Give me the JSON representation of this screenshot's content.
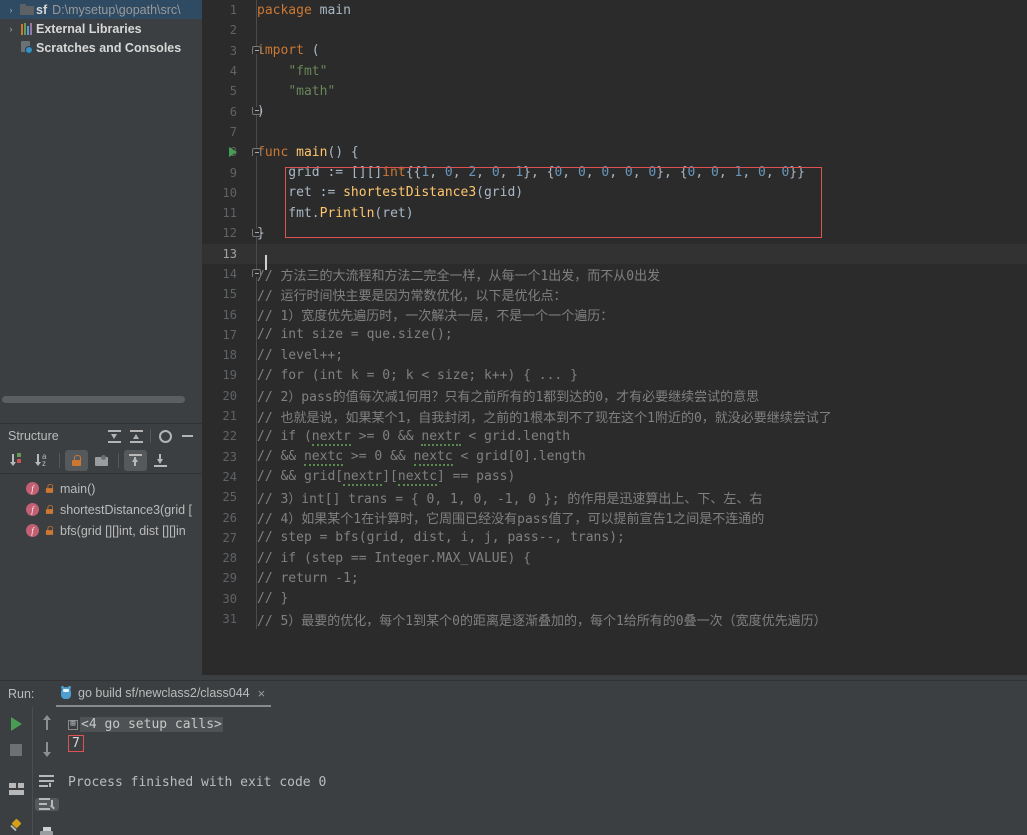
{
  "project": {
    "items": [
      {
        "arrow": "›",
        "icon": "folder-icon",
        "name": "sf",
        "path": "D:\\mysetup\\gopath\\src\\",
        "selected": true
      },
      {
        "arrow": "›",
        "icon": "external-libraries-icon",
        "name": "External Libraries",
        "path": "",
        "selected": false
      },
      {
        "arrow": "",
        "icon": "scratches-icon",
        "name": "Scratches and Consoles",
        "path": "",
        "selected": false
      }
    ]
  },
  "structure": {
    "title": "Structure",
    "header_buttons": [
      {
        "name": "expand-all-button",
        "icon": "expand-all-icon"
      },
      {
        "name": "collapse-all-button",
        "icon": "collapse-all-icon"
      },
      {
        "name": "settings-button",
        "icon": "gear-icon"
      },
      {
        "name": "hide-button",
        "icon": "minus-icon"
      }
    ],
    "toolbar_buttons": [
      {
        "name": "sort-by-visibility-button",
        "icon": "sort-visibility-icon",
        "active": false
      },
      {
        "name": "sort-alphabetically-button",
        "icon": "sort-alpha-icon",
        "active": false
      },
      {
        "name": "show-non-public-button",
        "icon": "lock-icon",
        "active": true
      },
      {
        "name": "show-anonymous-button",
        "icon": "anonymous-classes-icon",
        "active": false
      },
      {
        "name": "show-inherited-button",
        "icon": "arrow-up-bar-icon",
        "active": true
      },
      {
        "name": "show-imported-button",
        "icon": "arrow-down-bar-icon",
        "active": false
      }
    ],
    "items": [
      {
        "kind": "f",
        "label": "main()"
      },
      {
        "kind": "f",
        "label": "shortestDistance3(grid ["
      },
      {
        "kind": "f",
        "label": "bfs(grid [][]int, dist [][]in"
      }
    ]
  },
  "editor": {
    "lines": [
      {
        "n": 1,
        "fold": "",
        "run": false,
        "segs": [
          {
            "t": "package ",
            "c": "kw"
          },
          {
            "t": "main",
            "c": "txt"
          }
        ]
      },
      {
        "n": 2,
        "fold": "",
        "run": false,
        "segs": []
      },
      {
        "n": 3,
        "fold": "start",
        "run": false,
        "segs": [
          {
            "t": "import",
            "c": "kw"
          },
          {
            "t": " (",
            "c": "txt"
          }
        ]
      },
      {
        "n": 4,
        "fold": "",
        "run": false,
        "segs": [
          {
            "t": "    ",
            "c": "txt"
          },
          {
            "t": "\"fmt\"",
            "c": "str"
          }
        ]
      },
      {
        "n": 5,
        "fold": "",
        "run": false,
        "segs": [
          {
            "t": "    ",
            "c": "txt"
          },
          {
            "t": "\"math\"",
            "c": "str"
          }
        ]
      },
      {
        "n": 6,
        "fold": "end",
        "run": false,
        "segs": [
          {
            "t": ")",
            "c": "txt"
          }
        ]
      },
      {
        "n": 7,
        "fold": "",
        "run": false,
        "segs": []
      },
      {
        "n": 8,
        "fold": "start",
        "run": true,
        "segs": [
          {
            "t": "func ",
            "c": "kw"
          },
          {
            "t": "main",
            "c": "fn"
          },
          {
            "t": "() {",
            "c": "txt"
          }
        ]
      },
      {
        "n": 9,
        "fold": "",
        "run": false,
        "segs": [
          {
            "t": "    grid := [][]",
            "c": "txt"
          },
          {
            "t": "int",
            "c": "typ"
          },
          {
            "t": "{{",
            "c": "txt"
          },
          {
            "t": "1",
            "c": "num"
          },
          {
            "t": ", ",
            "c": "txt"
          },
          {
            "t": "0",
            "c": "num"
          },
          {
            "t": ", ",
            "c": "txt"
          },
          {
            "t": "2",
            "c": "num"
          },
          {
            "t": ", ",
            "c": "txt"
          },
          {
            "t": "0",
            "c": "num"
          },
          {
            "t": ", ",
            "c": "txt"
          },
          {
            "t": "1",
            "c": "num"
          },
          {
            "t": "}, {",
            "c": "txt"
          },
          {
            "t": "0",
            "c": "num"
          },
          {
            "t": ", ",
            "c": "txt"
          },
          {
            "t": "0",
            "c": "num"
          },
          {
            "t": ", ",
            "c": "txt"
          },
          {
            "t": "0",
            "c": "num"
          },
          {
            "t": ", ",
            "c": "txt"
          },
          {
            "t": "0",
            "c": "num"
          },
          {
            "t": ", ",
            "c": "txt"
          },
          {
            "t": "0",
            "c": "num"
          },
          {
            "t": "}, {",
            "c": "txt"
          },
          {
            "t": "0",
            "c": "num"
          },
          {
            "t": ", ",
            "c": "txt"
          },
          {
            "t": "0",
            "c": "num"
          },
          {
            "t": ", ",
            "c": "txt"
          },
          {
            "t": "1",
            "c": "num"
          },
          {
            "t": ", ",
            "c": "txt"
          },
          {
            "t": "0",
            "c": "num"
          },
          {
            "t": ", ",
            "c": "txt"
          },
          {
            "t": "0",
            "c": "num"
          },
          {
            "t": "}}",
            "c": "txt"
          }
        ]
      },
      {
        "n": 10,
        "fold": "",
        "run": false,
        "segs": [
          {
            "t": "    ret := ",
            "c": "txt"
          },
          {
            "t": "shortestDistance3",
            "c": "fn"
          },
          {
            "t": "(grid)",
            "c": "txt"
          }
        ]
      },
      {
        "n": 11,
        "fold": "",
        "run": false,
        "segs": [
          {
            "t": "    fmt.",
            "c": "txt"
          },
          {
            "t": "Println",
            "c": "fn"
          },
          {
            "t": "(ret)",
            "c": "txt"
          }
        ]
      },
      {
        "n": 12,
        "fold": "end",
        "run": false,
        "segs": [
          {
            "t": "}",
            "c": "txt"
          }
        ]
      },
      {
        "n": 13,
        "fold": "",
        "run": false,
        "current": true,
        "segs": []
      },
      {
        "n": 14,
        "fold": "start",
        "run": false,
        "segs": [
          {
            "t": "// 方法三的大流程和方法二完全一样，从每一个1出发，而不从0出发",
            "c": "cmt"
          }
        ]
      },
      {
        "n": 15,
        "fold": "",
        "run": false,
        "segs": [
          {
            "t": "// 运行时间快主要是因为常数优化，以下是优化点：",
            "c": "cmt"
          }
        ]
      },
      {
        "n": 16,
        "fold": "",
        "run": false,
        "segs": [
          {
            "t": "// 1）宽度优先遍历时，一次解决一层，不是一个一个遍历：",
            "c": "cmt"
          }
        ]
      },
      {
        "n": 17,
        "fold": "",
        "run": false,
        "segs": [
          {
            "t": "// int size = que.size();",
            "c": "cmt"
          }
        ]
      },
      {
        "n": 18,
        "fold": "",
        "run": false,
        "segs": [
          {
            "t": "// level++;",
            "c": "cmt"
          }
        ]
      },
      {
        "n": 19,
        "fold": "",
        "run": false,
        "segs": [
          {
            "t": "// for (int k = 0; k < size; k++) { ... }",
            "c": "cmt"
          }
        ]
      },
      {
        "n": 20,
        "fold": "",
        "run": false,
        "segs": [
          {
            "t": "// 2）pass的值每次减1何用？只有之前所有的1都到达的0，才有必要继续尝试的意思",
            "c": "cmt"
          }
        ]
      },
      {
        "n": 21,
        "fold": "",
        "run": false,
        "segs": [
          {
            "t": "// 也就是说，如果某个1，自我封闭，之前的1根本到不了现在这个1附近的0，就没必要继续尝试了",
            "c": "cmt"
          }
        ]
      },
      {
        "n": 22,
        "fold": "",
        "run": false,
        "segs": [
          {
            "t": "// if (",
            "c": "cmt"
          },
          {
            "t": "nextr",
            "c": "cmt",
            "wavy": true
          },
          {
            "t": " >= 0 && ",
            "c": "cmt"
          },
          {
            "t": "nextr",
            "c": "cmt",
            "wavy": true
          },
          {
            "t": " < grid.length",
            "c": "cmt"
          }
        ]
      },
      {
        "n": 23,
        "fold": "",
        "run": false,
        "segs": [
          {
            "t": "// && ",
            "c": "cmt"
          },
          {
            "t": "nextc",
            "c": "cmt",
            "wavy": true
          },
          {
            "t": " >= 0 && ",
            "c": "cmt"
          },
          {
            "t": "nextc",
            "c": "cmt",
            "wavy": true
          },
          {
            "t": " < grid[0].length",
            "c": "cmt"
          }
        ]
      },
      {
        "n": 24,
        "fold": "",
        "run": false,
        "segs": [
          {
            "t": "// && grid[",
            "c": "cmt"
          },
          {
            "t": "nextr",
            "c": "cmt",
            "wavy": true
          },
          {
            "t": "][",
            "c": "cmt"
          },
          {
            "t": "nextc",
            "c": "cmt",
            "wavy": true
          },
          {
            "t": "] == pass)",
            "c": "cmt"
          }
        ]
      },
      {
        "n": 25,
        "fold": "",
        "run": false,
        "segs": [
          {
            "t": "// 3）int[] trans = { 0, 1, 0, -1, 0 }; 的作用是迅速算出上、下、左、右",
            "c": "cmt"
          }
        ]
      },
      {
        "n": 26,
        "fold": "",
        "run": false,
        "segs": [
          {
            "t": "// 4）如果某个1在计算时，它周围已经没有pass值了，可以提前宣告1之间是不连通的",
            "c": "cmt"
          }
        ]
      },
      {
        "n": 27,
        "fold": "",
        "run": false,
        "segs": [
          {
            "t": "// step = bfs(grid, dist, i, j, pass--, trans);",
            "c": "cmt"
          }
        ]
      },
      {
        "n": 28,
        "fold": "",
        "run": false,
        "segs": [
          {
            "t": "// if (step == Integer.MAX_VALUE) {",
            "c": "cmt"
          }
        ]
      },
      {
        "n": 29,
        "fold": "",
        "run": false,
        "segs": [
          {
            "t": "// return -1;",
            "c": "cmt"
          }
        ]
      },
      {
        "n": 30,
        "fold": "",
        "run": false,
        "segs": [
          {
            "t": "// }",
            "c": "cmt"
          }
        ]
      },
      {
        "n": 31,
        "fold": "",
        "run": false,
        "segs": [
          {
            "t": "// 5）最要的优化，每个1到某个0的距离是逐渐叠加的，每个1给所有的0叠一次（宽度优先遍历）",
            "c": "cmt"
          }
        ]
      }
    ]
  },
  "run": {
    "label": "Run:",
    "tab_title": "go build sf/newclass2/class044",
    "tab_close": "×",
    "toolbar_left": [
      {
        "name": "rerun-button",
        "icon": "play-icon"
      },
      {
        "name": "stop-button",
        "icon": "stop-icon"
      },
      {
        "name": "layout-button",
        "icon": "layout-icon"
      },
      {
        "name": "pin-tab-button",
        "icon": "pin-icon"
      }
    ],
    "toolbar_second": [
      {
        "name": "up-stacktrace-button",
        "icon": "arrow-up-icon"
      },
      {
        "name": "down-stacktrace-button",
        "icon": "arrow-down-icon"
      },
      {
        "name": "soft-wrap-button",
        "icon": "soft-wrap-icon"
      },
      {
        "name": "scroll-to-end-button",
        "icon": "scroll-to-end-icon",
        "active": true
      },
      {
        "name": "print-button",
        "icon": "print-icon"
      }
    ],
    "console": {
      "fold_glyph": "⊞",
      "collapsed_text": "<4 go setup calls>",
      "output": "7",
      "exit_line": "Process finished with exit code 0"
    }
  },
  "colors": {
    "editor_bg": "#2b2b2b",
    "panel_bg": "#3c3f41",
    "selection": "#2f4a63",
    "highlight_red": "#e05252",
    "keyword": "#cc7832",
    "string": "#6a8759",
    "number": "#6897bb",
    "function": "#ffc66d",
    "comment": "#808080",
    "text": "#a9b7c6",
    "run_green": "#499c54"
  }
}
